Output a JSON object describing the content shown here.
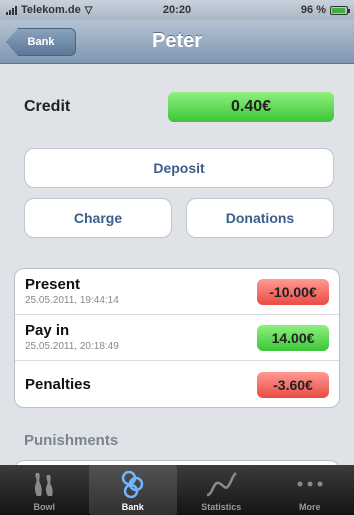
{
  "status_bar": {
    "carrier": "Telekom.de",
    "time": "20:20",
    "battery": "96 %"
  },
  "nav": {
    "back_label": "Bank",
    "title": "Peter"
  },
  "credit": {
    "label": "Credit",
    "value": "0.40€"
  },
  "buttons": {
    "deposit": "Deposit",
    "charge": "Charge",
    "donations": "Donations"
  },
  "transactions": [
    {
      "title": "Present",
      "date": "25.05.2011, 19:44:14",
      "amount": "-10.00€",
      "status": "negative"
    },
    {
      "title": "Pay in",
      "date": "25.05.2011, 20:18:49",
      "amount": "14.00€",
      "status": "positive"
    },
    {
      "title": "Penalties",
      "date": "",
      "amount": "-3.60€",
      "status": "negative"
    }
  ],
  "section": {
    "punishments": "Punishments"
  },
  "tabs": [
    {
      "label": "Bowl",
      "icon": "bowling-pin-icon",
      "active": false
    },
    {
      "label": "Bank",
      "icon": "coins-icon",
      "active": true
    },
    {
      "label": "Statistics",
      "icon": "chart-line-icon",
      "active": false
    },
    {
      "label": "More",
      "icon": "more-dots-icon",
      "active": false
    }
  ],
  "colors": {
    "positive": "#3bc637",
    "negative": "#e94b44",
    "nav": "#7f97b2",
    "link": "#3b5e8c"
  }
}
